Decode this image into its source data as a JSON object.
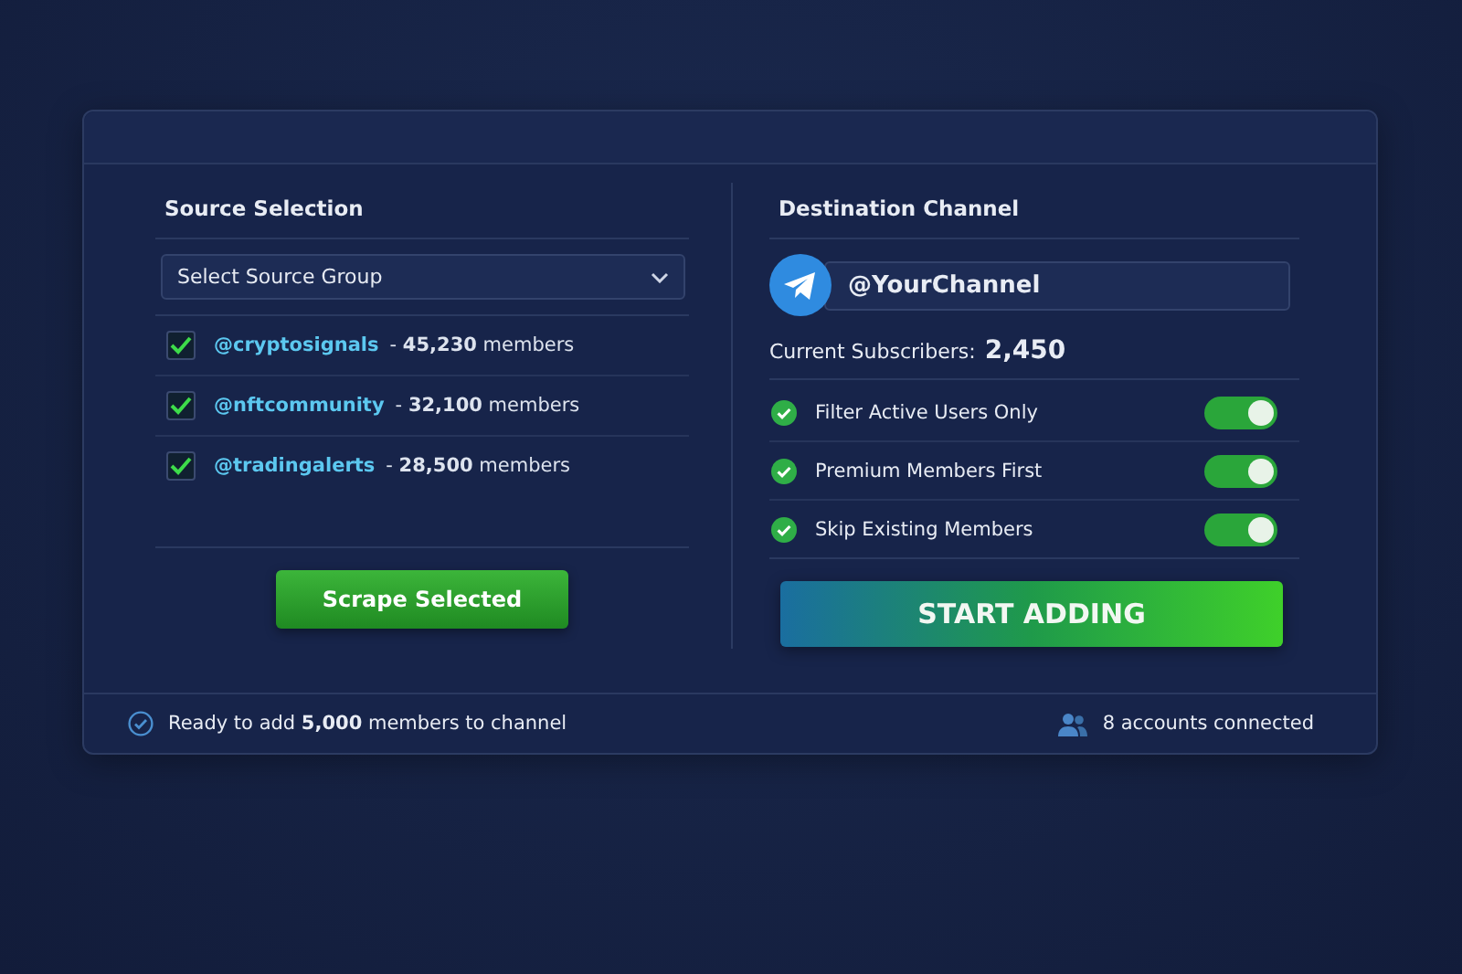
{
  "source": {
    "title": "Source Selection",
    "dropdown": {
      "value": "Select Source Group"
    },
    "groups": [
      {
        "handle": "@cryptosignals",
        "count": "- **45,230** members",
        "checked": true
      },
      {
        "handle": "@nftcommunity",
        "count": "- **32,100** members",
        "checked": true
      },
      {
        "handle": "@tradingalerts",
        "count": "- **28,500** members",
        "checked": true
      }
    ],
    "button": "Scrape Selected"
  },
  "destination": {
    "title": "Destination Channel",
    "channel": "@YourChannel",
    "subscribers_label": "Current Subscribers:",
    "subscribers": "2,450",
    "options": [
      {
        "label": "Filter Active Users Only",
        "on": true
      },
      {
        "label": "Premium Members First",
        "on": true
      },
      {
        "label": "Skip Existing Members",
        "on": true
      }
    ],
    "button": "START ADDING"
  },
  "status_bar": {
    "message": "Ready to add **5,000** members to channel",
    "accounts": "8 accounts connected"
  }
}
